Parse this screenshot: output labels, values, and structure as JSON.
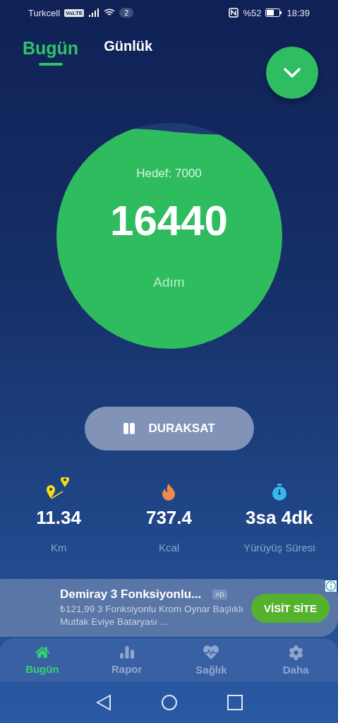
{
  "status_bar": {
    "carrier": "Turkcell",
    "volte": "VoLTE",
    "notifications": "2",
    "battery": "%52",
    "time": "18:39"
  },
  "tabs": [
    {
      "label": "Bugün",
      "selected": true
    },
    {
      "label": "Günlük",
      "selected": false
    }
  ],
  "progress": {
    "goal": "Hedef: 7000",
    "steps": "16440",
    "unit": "Adım"
  },
  "pause_button": {
    "label": "DURAKSAT"
  },
  "stats": [
    {
      "kind": "distance",
      "value": "11.34",
      "label": "Km"
    },
    {
      "kind": "calories",
      "value": "737.4",
      "label": "Kcal"
    },
    {
      "kind": "time",
      "value": "3sa 4dk",
      "label": "Yürüyüş Süresi"
    }
  ],
  "ad": {
    "title": "Demiray 3 Fonksiyonlu...",
    "badge": "AD",
    "description": "₺121,99 3 Fonksiyonlu Krom Oynar Başlıklı Mutfak Eviye Bataryası ...",
    "button": "VİSİT SİTE"
  },
  "nav": [
    {
      "kind": "home",
      "label": "Bugün",
      "selected": true
    },
    {
      "kind": "report",
      "label": "Rapor",
      "selected": false
    },
    {
      "kind": "health",
      "label": "Sağlık",
      "selected": false
    },
    {
      "kind": "settings",
      "label": "Daha",
      "selected": false
    }
  ]
}
